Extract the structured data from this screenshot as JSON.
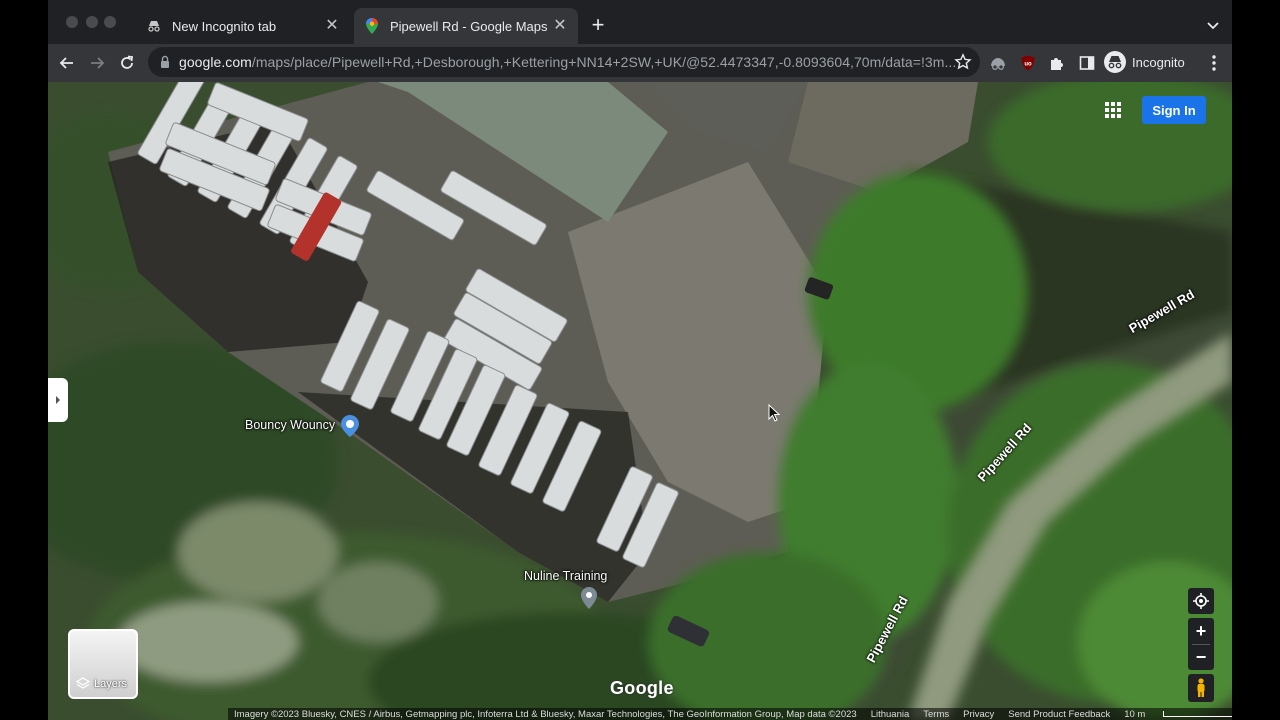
{
  "tabs": [
    {
      "label": "New Incognito tab",
      "icon": "incognito-icon"
    },
    {
      "label": "Pipewell Rd - Google Maps",
      "icon": "google-maps-icon",
      "active": true
    }
  ],
  "toolbar": {
    "url_host": "google.com",
    "url_rest": "/maps/place/Pipewell+Rd,+Desborough,+Kettering+NN14+2SW,+UK/@52.4473347,-0.8093604,70m/data=!3m...",
    "profile_label": "Incognito"
  },
  "map": {
    "view": "satellite",
    "sign_in": "Sign In",
    "road_labels": [
      "Pipewell Rd",
      "Pipewell Rd",
      "Pipewell Rd"
    ],
    "places": [
      {
        "name": "Bouncy Wouncy",
        "pin_color": "#4a8fe0"
      },
      {
        "name": "Nuline Training",
        "pin_color": "#7d8a96"
      }
    ],
    "layers_label": "Layers",
    "logo": "Google",
    "footer": {
      "imagery": "Imagery ©2023 Bluesky, CNES / Airbus, Getmapping plc, Infoterra Ltd & Bluesky, Maxar Technologies, The GeoInformation Group, Map data ©2023",
      "region": "Lithuania",
      "terms": "Terms",
      "privacy": "Privacy",
      "feedback": "Send Product Feedback",
      "scale": "10 m"
    }
  },
  "colors": {
    "accent": "#1a73e8",
    "chrome_dark": "#202124",
    "chrome_toolbar": "#35363a"
  }
}
